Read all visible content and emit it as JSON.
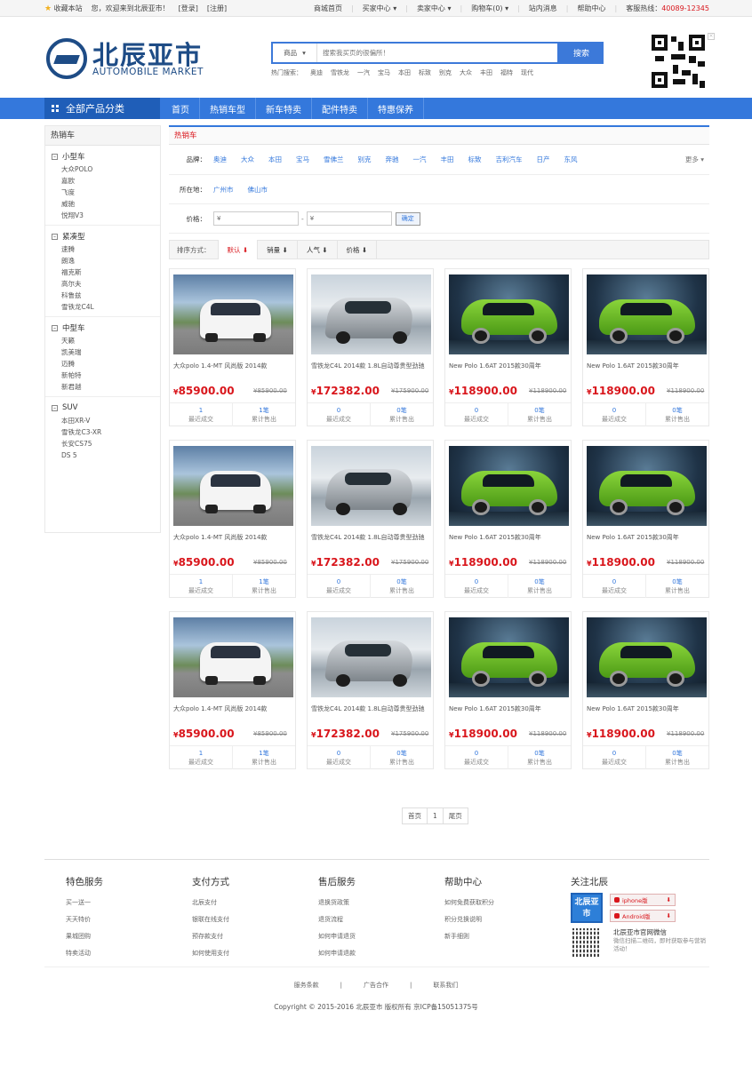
{
  "topbar": {
    "fav": "收藏本站",
    "welcome": "您，欢迎来到北辰亚市！",
    "login": "[登录]",
    "register": "[注册]",
    "links": [
      "商城首页",
      "买家中心 ▾",
      "卖家中心 ▾",
      "购物车(0) ▾",
      "站内消息",
      "帮助中心"
    ],
    "hotline_label": "客服热线：",
    "hotline": "40089-12345"
  },
  "logo": {
    "cn": "北辰亚市",
    "en": "AUTOMOBILE MARKET"
  },
  "search": {
    "category": "商品",
    "placeholder": "搜索我买页的很偏所！",
    "button": "搜索",
    "hot_label": "热门搜索：",
    "hot_words": [
      "奥迪",
      "雪铁龙",
      "一汽",
      "宝马",
      "本田",
      "标致",
      "别克",
      "大众",
      "丰田",
      "福特",
      "现代"
    ]
  },
  "nav": {
    "all_categories": "全部产品分类",
    "links": [
      "首页",
      "热销车型",
      "新车特卖",
      "配件特卖",
      "特惠保养"
    ]
  },
  "sidebar": {
    "title": "热销车",
    "groups": [
      {
        "title": "小型车",
        "items": [
          "大众POLO",
          "嘉欧",
          "飞度",
          "威驰",
          "悦翔V3"
        ]
      },
      {
        "title": "紧凑型",
        "items": [
          "速腾",
          "朗逸",
          "福克斯",
          "高尔夫",
          "科鲁兹",
          "雪铁龙C4L"
        ]
      },
      {
        "title": "中型车",
        "items": [
          "天籁",
          "凯美瑞",
          "迈腾",
          "新帕特",
          "新君越"
        ]
      },
      {
        "title": "SUV",
        "items": [
          "本田XR-V",
          "雪铁龙C3-XR",
          "长安CS75",
          "DS 5"
        ]
      }
    ]
  },
  "filters": {
    "title": "热销车",
    "brand_label": "品牌：",
    "brands": [
      "奥迪",
      "大众",
      "本田",
      "宝马",
      "雪佛兰",
      "别克",
      "奔驰",
      "一汽",
      "丰田",
      "标致",
      "吉利汽车",
      "日产",
      "东风"
    ],
    "more": "更多 ▾",
    "location_label": "所在地：",
    "locations": [
      "广州市",
      "佛山市"
    ],
    "price_label": "价格：",
    "price_from": "¥",
    "price_to": "¥",
    "price_dash": "-",
    "ok": "确定"
  },
  "sort": {
    "label": "排序方式：",
    "options": [
      "默认 ⬇",
      "销量 ⬇",
      "人气 ⬇",
      "价格 ⬇"
    ]
  },
  "products": [
    {
      "name": "大众polo 1.4-MT 风尚版 2014款",
      "price": "85900.00",
      "old": "¥85900.00",
      "deals": "1",
      "deals_label": "最近成交",
      "sold": "1笔",
      "sold_label": "累计售出",
      "img": "white"
    },
    {
      "name": "雪铁龙C4L 2014款 1.8L自动尊贵型劲驰",
      "price": "172382.00",
      "old": "¥175900.00",
      "deals": "0",
      "deals_label": "最近成交",
      "sold": "0笔",
      "sold_label": "累计售出",
      "img": "silver"
    },
    {
      "name": "New Polo 1.6AT 2015款30周年",
      "price": "118900.00",
      "old": "¥118900.00",
      "deals": "0",
      "deals_label": "最近成交",
      "sold": "0笔",
      "sold_label": "累计售出",
      "img": "green"
    },
    {
      "name": "New Polo 1.6AT 2015款30周年",
      "price": "118900.00",
      "old": "¥118900.00",
      "deals": "0",
      "deals_label": "最近成交",
      "sold": "0笔",
      "sold_label": "累计售出",
      "img": "green"
    },
    {
      "name": "大众polo 1.4-MT 风尚版 2014款",
      "price": "85900.00",
      "old": "¥85900.00",
      "deals": "1",
      "deals_label": "最近成交",
      "sold": "1笔",
      "sold_label": "累计售出",
      "img": "white"
    },
    {
      "name": "雪铁龙C4L 2014款 1.8L自动尊贵型劲驰",
      "price": "172382.00",
      "old": "¥175900.00",
      "deals": "0",
      "deals_label": "最近成交",
      "sold": "0笔",
      "sold_label": "累计售出",
      "img": "silver"
    },
    {
      "name": "New Polo 1.6AT 2015款30周年",
      "price": "118900.00",
      "old": "¥118900.00",
      "deals": "0",
      "deals_label": "最近成交",
      "sold": "0笔",
      "sold_label": "累计售出",
      "img": "green"
    },
    {
      "name": "New Polo 1.6AT 2015款30周年",
      "price": "118900.00",
      "old": "¥118900.00",
      "deals": "0",
      "deals_label": "最近成交",
      "sold": "0笔",
      "sold_label": "累计售出",
      "img": "green"
    },
    {
      "name": "大众polo 1.4-MT 风尚版 2014款",
      "price": "85900.00",
      "old": "¥85900.00",
      "deals": "1",
      "deals_label": "最近成交",
      "sold": "1笔",
      "sold_label": "累计售出",
      "img": "white"
    },
    {
      "name": "雪铁龙C4L 2014款 1.8L自动尊贵型劲驰",
      "price": "172382.00",
      "old": "¥175900.00",
      "deals": "0",
      "deals_label": "最近成交",
      "sold": "0笔",
      "sold_label": "累计售出",
      "img": "silver"
    },
    {
      "name": "New Polo 1.6AT 2015款30周年",
      "price": "118900.00",
      "old": "¥118900.00",
      "deals": "0",
      "deals_label": "最近成交",
      "sold": "0笔",
      "sold_label": "累计售出",
      "img": "green"
    },
    {
      "name": "New Polo 1.6AT 2015款30周年",
      "price": "118900.00",
      "old": "¥118900.00",
      "deals": "0",
      "deals_label": "最近成交",
      "sold": "0笔",
      "sold_label": "累计售出",
      "img": "green"
    }
  ],
  "currency": "¥",
  "pager": [
    "首页",
    "1",
    "尾页"
  ],
  "footer": {
    "cols": [
      {
        "title": "特色服务",
        "items": [
          "买一送一",
          "天天特价",
          "果城团购",
          "特卖活动"
        ]
      },
      {
        "title": "支付方式",
        "items": [
          "北辰支付",
          "银联在线支付",
          "预存款支付",
          "如何使用支付"
        ]
      },
      {
        "title": "售后服务",
        "items": [
          "退换货政策",
          "退货流程",
          "如何申请退货",
          "如何申请退款"
        ]
      },
      {
        "title": "帮助中心",
        "items": [
          "如何免费获取积分",
          "积分兑换说明",
          "新手细则"
        ]
      }
    ],
    "follow_title": "关注北辰",
    "app_name": "北辰亚市",
    "iphone": "iphone版",
    "android": "Android版",
    "wx_title": "北辰亚市官网微信",
    "wx_desc": "微信扫描二维码，即时获取参与营销活动！",
    "links": [
      "服务条款",
      "广告合作",
      "联系我们"
    ],
    "sep": "|",
    "copyright": "Copyright © 2015-2016  北辰亚市 版权所有 京ICP备15051375号"
  },
  "colors": {
    "brand_blue": "#3478dc",
    "price_red": "#d9161c",
    "logo_blue": "#1e4c86"
  }
}
